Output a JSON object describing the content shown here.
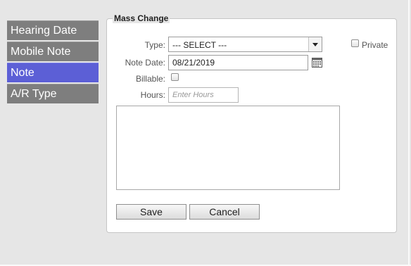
{
  "sidebar": {
    "items": [
      {
        "label": "Hearing Date"
      },
      {
        "label": "Mobile Note"
      },
      {
        "label": "Note",
        "active": true
      },
      {
        "label": "A/R Type"
      }
    ]
  },
  "form": {
    "legend": "Mass Change",
    "type_label": "Type:",
    "type_selected": "--- SELECT ---",
    "private_label": "Private",
    "private_checked": false,
    "note_date_label": "Note Date:",
    "note_date_value": "08/21/2019",
    "billable_label": "Billable:",
    "billable_checked": false,
    "hours_label": "Hours:",
    "hours_placeholder": "Enter Hours",
    "note_text": ""
  },
  "buttons": {
    "save": "Save",
    "cancel": "Cancel"
  },
  "icons": {
    "calendar": "calendar-icon",
    "dropdown": "chevron-down-icon"
  },
  "colors": {
    "active_item": "#5c5fd6",
    "inactive_item": "#7e7e7e",
    "background": "#e6e6e6"
  }
}
